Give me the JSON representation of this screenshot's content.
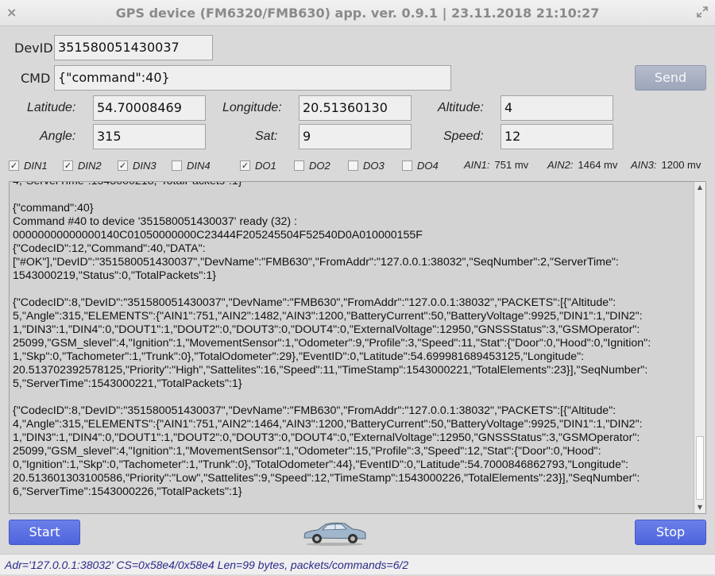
{
  "window": {
    "title": "GPS device (FM6320/FMB630) app. ver. 0.9.1 | 23.11.2018 21:10:27",
    "close_icon": "×"
  },
  "form": {
    "devid_label": "DevID",
    "devid_value": "351580051430037",
    "cmd_label": "CMD",
    "cmd_value": "{\"command\":40}",
    "send_label": "Send",
    "latitude_label": "Latitude:",
    "latitude_value": "54.70008469",
    "longitude_label": "Longitude:",
    "longitude_value": "20.51360130",
    "altitude_label": "Altitude:",
    "altitude_value": "4",
    "angle_label": "Angle:",
    "angle_value": "315",
    "sat_label": "Sat:",
    "sat_value": "9",
    "speed_label": "Speed:",
    "speed_value": "12"
  },
  "io": {
    "din1": {
      "label": "DIN1",
      "checked": true,
      "mark": "✓"
    },
    "din2": {
      "label": "DIN2",
      "checked": true,
      "mark": "✓"
    },
    "din3": {
      "label": "DIN3",
      "checked": true,
      "mark": "✓"
    },
    "din4": {
      "label": "DIN4",
      "checked": false,
      "mark": ""
    },
    "do1": {
      "label": "DO1",
      "checked": true,
      "mark": "✓"
    },
    "do2": {
      "label": "DO2",
      "checked": false,
      "mark": ""
    },
    "do3": {
      "label": "DO3",
      "checked": false,
      "mark": ""
    },
    "do4": {
      "label": "DO4",
      "checked": false,
      "mark": ""
    },
    "ain1": {
      "label": "AIN1:",
      "value": "751 mv"
    },
    "ain2": {
      "label": "AIN2:",
      "value": "1464 mv"
    },
    "ain3": {
      "label": "AIN3:",
      "value": "1200 mv"
    }
  },
  "log": {
    "partial_top": "4,\"ServerTime\":1543000218,\"TotalPackets\":1}",
    "lines": [
      "{\"command\":40}\nCommand #40 to device '351580051430037' ready (32) :\n00000000000000140C01050000000C23444F205245504F52540D0A010000155F\n{\"CodecID\":12,\"Command\":40,\"DATA\":\n[\"#OK\"],\"DevID\":\"351580051430037\",\"DevName\":\"FMB630\",\"FromAddr\":\"127.0.0.1:38032\",\"SeqNumber\":2,\"ServerTime\":\n1543000219,\"Status\":0,\"TotalPackets\":1}",
      "{\"CodecID\":8,\"DevID\":\"351580051430037\",\"DevName\":\"FMB630\",\"FromAddr\":\"127.0.0.1:38032\",\"PACKETS\":[{\"Altitude\":\n5,\"Angle\":315,\"ELEMENTS\":{\"AIN1\":751,\"AIN2\":1482,\"AIN3\":1200,\"BatteryCurrent\":50,\"BatteryVoltage\":9925,\"DIN1\":1,\"DIN2\":\n1,\"DIN3\":1,\"DIN4\":0,\"DOUT1\":1,\"DOUT2\":0,\"DOUT3\":0,\"DOUT4\":0,\"ExternalVoltage\":12950,\"GNSSStatus\":3,\"GSMOperator\":\n25099,\"GSM_slevel\":4,\"Ignition\":1,\"MovementSensor\":1,\"Odometer\":9,\"Profile\":3,\"Speed\":11,\"Stat\":{\"Door\":0,\"Hood\":0,\"Ignition\":\n1,\"Skp\":0,\"Tachometer\":1,\"Trunk\":0},\"TotalOdometer\":29},\"EventID\":0,\"Latitude\":54.699981689453125,\"Longitude\":\n20.513702392578125,\"Priority\":\"High\",\"Sattelites\":16,\"Speed\":11,\"TimeStamp\":1543000221,\"TotalElements\":23}],\"SeqNumber\":\n5,\"ServerTime\":1543000221,\"TotalPackets\":1}",
      "{\"CodecID\":8,\"DevID\":\"351580051430037\",\"DevName\":\"FMB630\",\"FromAddr\":\"127.0.0.1:38032\",\"PACKETS\":[{\"Altitude\":\n4,\"Angle\":315,\"ELEMENTS\":{\"AIN1\":751,\"AIN2\":1464,\"AIN3\":1200,\"BatteryCurrent\":50,\"BatteryVoltage\":9925,\"DIN1\":1,\"DIN2\":\n1,\"DIN3\":1,\"DIN4\":0,\"DOUT1\":1,\"DOUT2\":0,\"DOUT3\":0,\"DOUT4\":0,\"ExternalVoltage\":12950,\"GNSSStatus\":3,\"GSMOperator\":\n25099,\"GSM_slevel\":4,\"Ignition\":1,\"MovementSensor\":1,\"Odometer\":15,\"Profile\":3,\"Speed\":12,\"Stat\":{\"Door\":0,\"Hood\":\n0,\"Ignition\":1,\"Skp\":0,\"Tachometer\":1,\"Trunk\":0},\"TotalOdometer\":44},\"EventID\":0,\"Latitude\":54.7000846862793,\"Longitude\":\n20.513601303100586,\"Priority\":\"Low\",\"Sattelites\":9,\"Speed\":12,\"TimeStamp\":1543000226,\"TotalElements\":23}],\"SeqNumber\":\n6,\"ServerTime\":1543000226,\"TotalPackets\":1}"
    ],
    "scroll_up_icon": "▲",
    "scroll_down_icon": "▼"
  },
  "actions": {
    "start_label": "Start",
    "stop_label": "Stop",
    "car_icon": "car-icon"
  },
  "status": {
    "text": "Adr='127.0.0.1:38032' CS=0x58e4/0x58e4 Len=99 bytes, packets/commands=6/2"
  },
  "colors": {
    "button_blue": "#5a6fe3",
    "button_gray": "#a7aec2",
    "background": "#d9d9d9",
    "status_text": "#2a2a8a"
  }
}
